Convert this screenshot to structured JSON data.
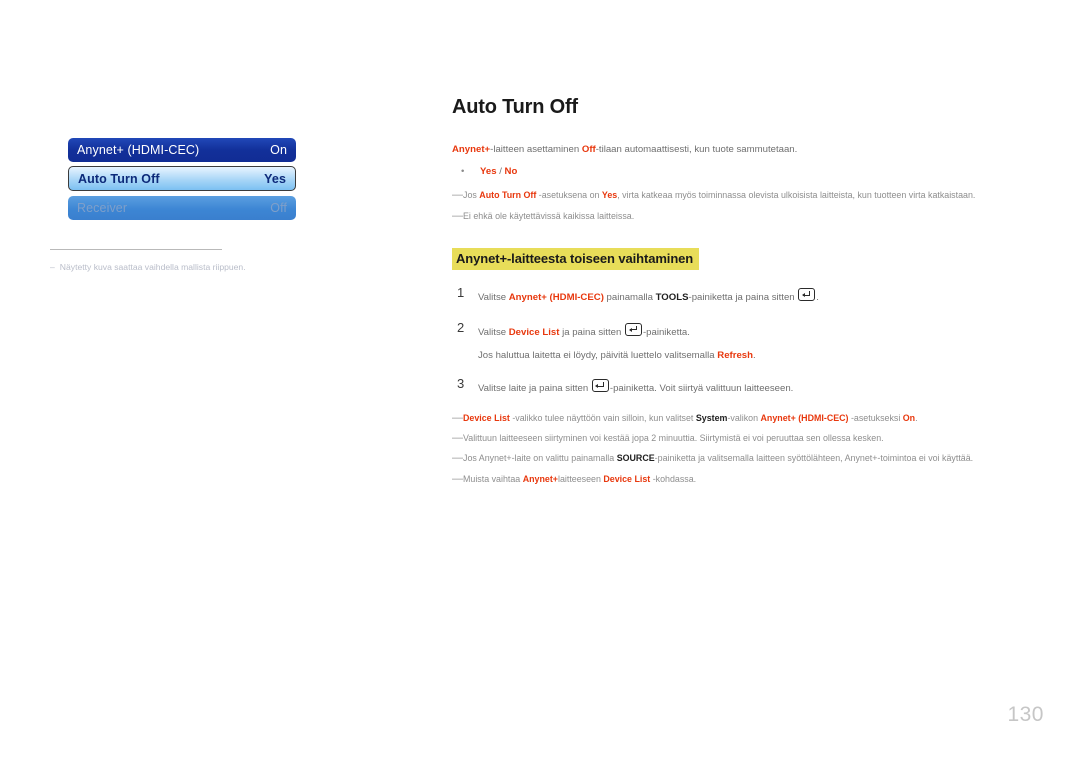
{
  "page_title": "Auto Turn Off",
  "page_number": "130",
  "colors": {
    "accent_red": "#E8380E",
    "highlight_yellow": "#E8DD59",
    "osd_header_blue": "#12309A",
    "osd_selected_blue": "#A9D6F7",
    "osd_disabled_blue": "#3D86D4",
    "body_gray": "#6F6F6F",
    "page_number_gray": "#C6C6C6"
  },
  "osd_figure": {
    "rows": [
      {
        "label": "Anynet+ (HDMI-CEC)",
        "value": "On",
        "state": "header"
      },
      {
        "label": "Auto Turn Off",
        "value": "Yes",
        "state": "selected"
      },
      {
        "label": "Receiver",
        "value": "Off",
        "state": "disabled"
      }
    ],
    "caption_dash": "–",
    "caption": "Näytetty kuva saattaa vaihdella mallista riippuen."
  },
  "intro": {
    "line_parts": [
      {
        "text": "Anynet+",
        "style": "red"
      },
      {
        "text": "-laitteen asettaminen ",
        "style": "plain"
      },
      {
        "text": "Off",
        "style": "red"
      },
      {
        "text": "-tilaan automaattisesti, kun tuote sammutetaan.",
        "style": "plain"
      }
    ],
    "bullet_dot": "•",
    "bullet_parts": [
      {
        "text": "Yes",
        "style": "red"
      },
      {
        "text": " / ",
        "style": "plain"
      },
      {
        "text": "No",
        "style": "red"
      }
    ]
  },
  "intro_notes": [
    {
      "dash": "—",
      "parts": [
        {
          "text": "Jos ",
          "style": "plain"
        },
        {
          "text": "Auto Turn Off",
          "style": "red"
        },
        {
          "text": " -asetuksena on ",
          "style": "plain"
        },
        {
          "text": "Yes",
          "style": "red"
        },
        {
          "text": ", virta katkeaa myös toiminnassa olevista ulkoisista laitteista, kun tuotteen virta katkaistaan.",
          "style": "plain"
        }
      ]
    },
    {
      "dash": "—",
      "parts": [
        {
          "text": "Ei ehkä ole käytettävissä kaikissa laitteissa.",
          "style": "plain"
        }
      ]
    }
  ],
  "section_heading": "Anynet+-laitteesta toiseen vaihtaminen",
  "steps": [
    {
      "number": "1",
      "parts": [
        {
          "text": "Valitse ",
          "style": "plain"
        },
        {
          "text": "Anynet+ (HDMI-CEC)",
          "style": "red"
        },
        {
          "text": " painamalla ",
          "style": "plain"
        },
        {
          "text": "TOOLS",
          "style": "black"
        },
        {
          "text": "-painiketta ja paina sitten ",
          "style": "plain"
        },
        {
          "text": "",
          "style": "enter-key"
        },
        {
          "text": ".",
          "style": "plain"
        }
      ]
    },
    {
      "number": "2",
      "parts": [
        {
          "text": "Valitse ",
          "style": "plain"
        },
        {
          "text": "Device List",
          "style": "red"
        },
        {
          "text": " ja paina sitten ",
          "style": "plain"
        },
        {
          "text": "",
          "style": "enter-key"
        },
        {
          "text": "-painiketta.",
          "style": "plain"
        }
      ],
      "substep_parts": [
        {
          "text": "Jos haluttua laitetta ei löydy, päivitä luettelo valitsemalla ",
          "style": "plain"
        },
        {
          "text": "Refresh",
          "style": "red"
        },
        {
          "text": ".",
          "style": "plain"
        }
      ]
    },
    {
      "number": "3",
      "parts": [
        {
          "text": "Valitse laite ja paina sitten ",
          "style": "plain"
        },
        {
          "text": "",
          "style": "enter-key"
        },
        {
          "text": "-painiketta. Voit siirtyä valittuun laitteeseen.",
          "style": "plain"
        }
      ]
    }
  ],
  "footer_notes": [
    {
      "dash": "—",
      "parts": [
        {
          "text": "Device List",
          "style": "red"
        },
        {
          "text": " -valikko tulee näyttöön vain silloin, kun valitset ",
          "style": "plain"
        },
        {
          "text": "System",
          "style": "black"
        },
        {
          "text": "-valikon ",
          "style": "plain"
        },
        {
          "text": "Anynet+ (HDMI-CEC)",
          "style": "red"
        },
        {
          "text": " -asetukseksi ",
          "style": "plain"
        },
        {
          "text": "On",
          "style": "red"
        },
        {
          "text": ".",
          "style": "plain"
        }
      ]
    },
    {
      "dash": "—",
      "parts": [
        {
          "text": "Valittuun laitteeseen siirtyminen voi kestää jopa 2 minuuttia. Siirtymistä ei voi peruuttaa sen ollessa kesken.",
          "style": "plain"
        }
      ]
    },
    {
      "dash": "—",
      "parts": [
        {
          "text": "Jos Anynet+-laite on valittu painamalla ",
          "style": "plain"
        },
        {
          "text": "SOURCE",
          "style": "black"
        },
        {
          "text": "-painiketta ja valitsemalla laitteen syöttölähteen, Anynet+-toimintoa ei voi käyttää.",
          "style": "plain"
        }
      ]
    },
    {
      "dash": "—",
      "parts": [
        {
          "text": "Muista vaihtaa ",
          "style": "plain"
        },
        {
          "text": "Anynet+",
          "style": "red"
        },
        {
          "text": "laitteeseen ",
          "style": "plain"
        },
        {
          "text": "Device List",
          "style": "red"
        },
        {
          "text": " -kohdassa.",
          "style": "plain"
        }
      ]
    }
  ]
}
